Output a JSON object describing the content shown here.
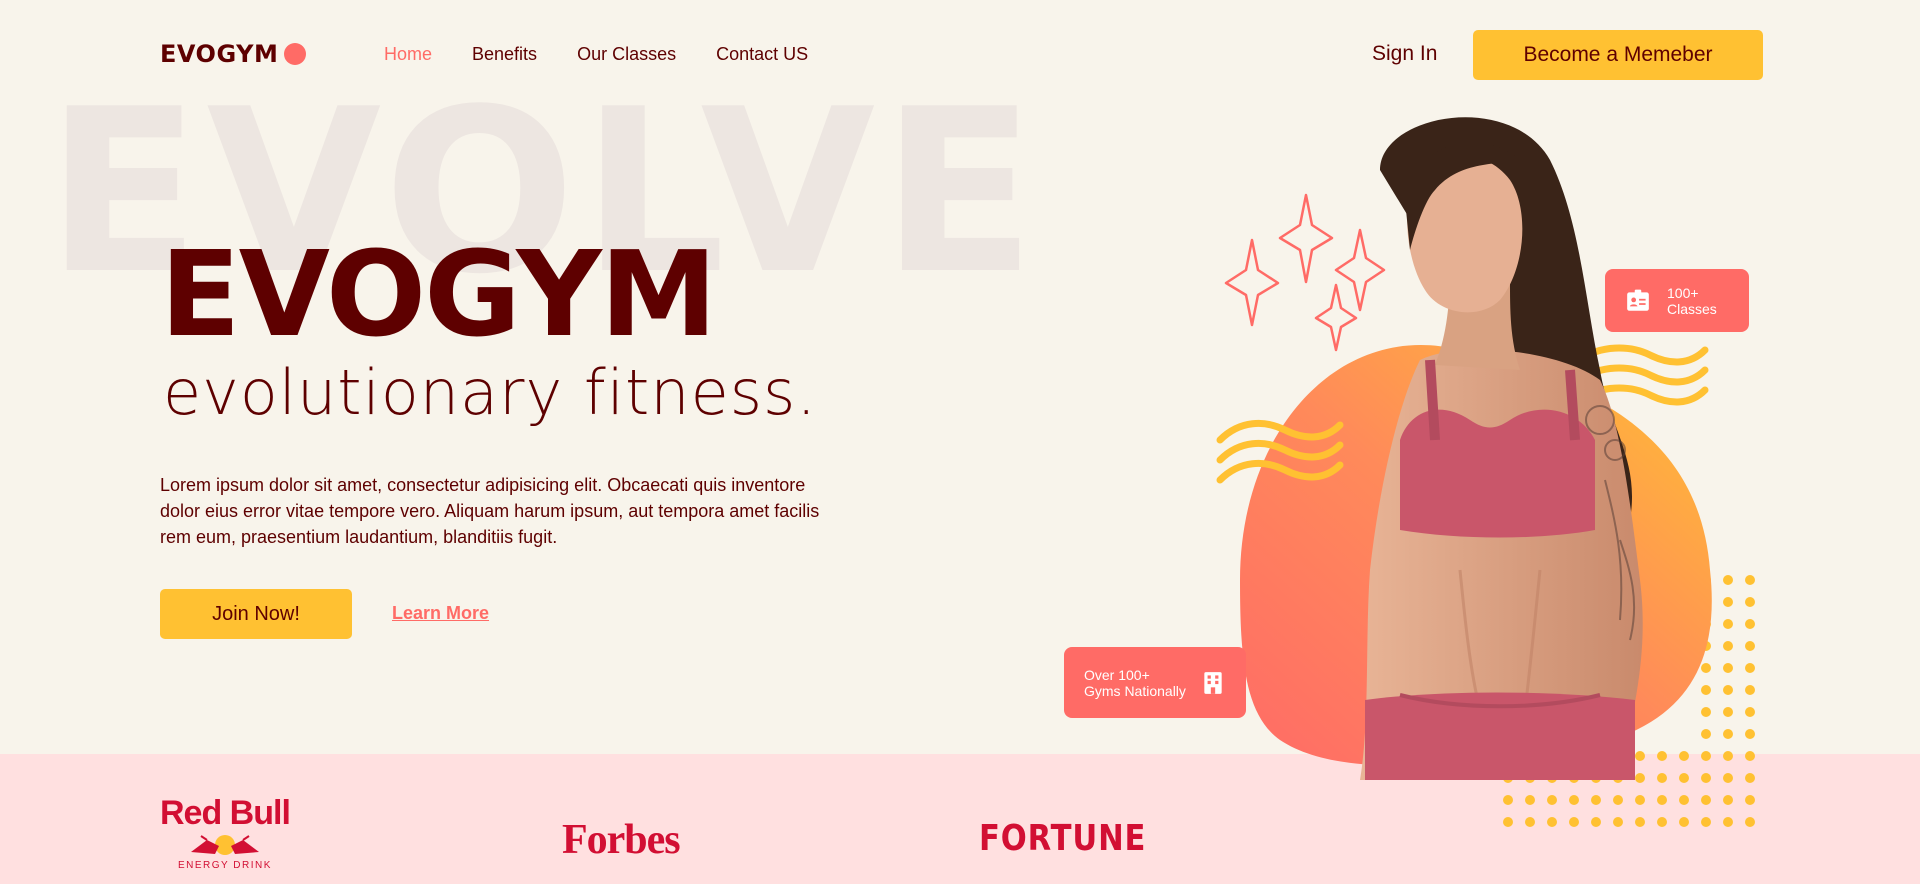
{
  "brand": {
    "name": "EVOGYM"
  },
  "nav": {
    "links": [
      {
        "label": "Home",
        "active": true
      },
      {
        "label": "Benefits",
        "active": false
      },
      {
        "label": "Our Classes",
        "active": false
      },
      {
        "label": "Contact US",
        "active": false
      }
    ],
    "sign_in": "Sign In",
    "cta": "Become a Memeber"
  },
  "hero": {
    "background_word": "EVOLVE",
    "title": "EVOGYM",
    "tagline": "evolutionary fitness.",
    "description": "Lorem ipsum dolor sit amet, consectetur adipisicing elit. Obcaecati quis inventore dolor eius error vitae tempore vero. Aliquam harum ipsum, aut tempora amet facilis rem eum, praesentium laudantium, blanditiis fugit.",
    "join_button": "Join Now!",
    "learn_more": "Learn More"
  },
  "stats": {
    "classes": {
      "line1": "100+",
      "line2": "Classes",
      "icon": "id-card-icon"
    },
    "gyms": {
      "line1": "Over 100+",
      "line2": "Gyms Nationally",
      "icon": "building-icon"
    }
  },
  "sponsors": {
    "redbull": {
      "name": "Red Bull",
      "sub": "ENERGY DRINK"
    },
    "forbes": "Forbes",
    "fortune": "FORTUNE"
  },
  "colors": {
    "background": "#f8f4eb",
    "primary_dark": "#5e0000",
    "accent_red": "#ff6b66",
    "accent_yellow": "#ffc132",
    "sponsor_bar": "#ffe0e0",
    "sponsor_red": "#d20f33"
  }
}
